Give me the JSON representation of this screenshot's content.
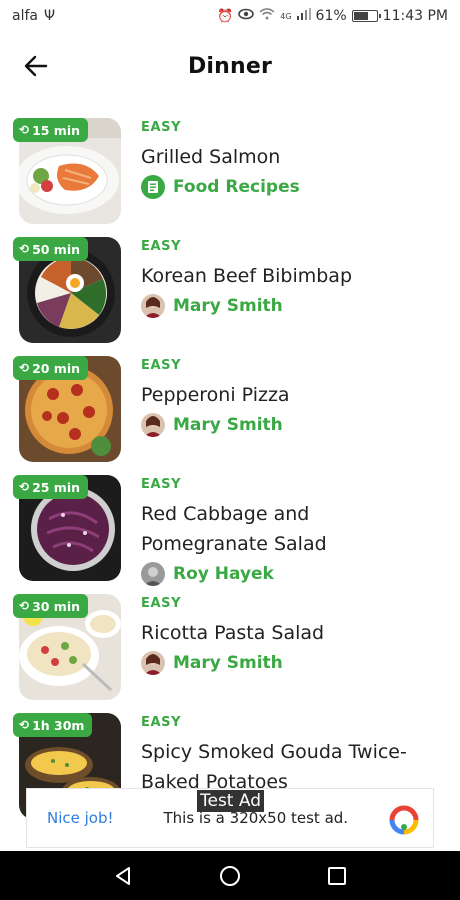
{
  "status": {
    "carrier": "alfa",
    "usb_symbol": "Ψ",
    "network_type": "4G",
    "battery": "61%",
    "battery_level": 0.61,
    "time": "11:43 PM"
  },
  "header": {
    "title": "Dinner"
  },
  "recipes": [
    {
      "time": "15 min",
      "difficulty": "EASY",
      "name": "Grilled Salmon",
      "author": "Food Recipes",
      "author_type": "brand"
    },
    {
      "time": "50 min",
      "difficulty": "EASY",
      "name": "Korean Beef Bibimbap",
      "author": "Mary Smith",
      "author_type": "user"
    },
    {
      "time": "20 min",
      "difficulty": "EASY",
      "name": "Pepperoni Pizza",
      "author": "Mary Smith",
      "author_type": "user"
    },
    {
      "time": "25 min",
      "difficulty": "EASY",
      "name": "Red Cabbage and Pomegranate Salad",
      "author": "Roy Hayek",
      "author_type": "user"
    },
    {
      "time": "30 min",
      "difficulty": "EASY",
      "name": "Ricotta Pasta Salad",
      "author": "Mary Smith",
      "author_type": "user"
    },
    {
      "time": "1h 30m",
      "difficulty": "EASY",
      "name": "Spicy Smoked Gouda Twice-Baked Potatoes",
      "author": "",
      "author_type": "none"
    }
  ],
  "ad": {
    "label": "Test Ad",
    "nice": "Nice job!",
    "text": "This is a 320x50 test ad."
  },
  "colors": {
    "accent": "#3aa843",
    "ad_link": "#2e7de1",
    "nav_bar": "#000000"
  }
}
